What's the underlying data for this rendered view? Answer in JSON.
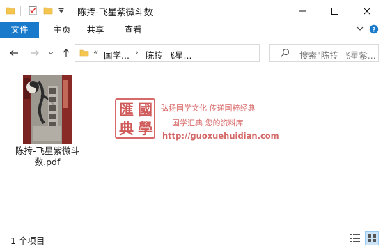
{
  "window": {
    "title": "陈抟-飞星紫微斗数"
  },
  "ribbon": {
    "tabs": [
      "文件",
      "主页",
      "共享",
      "查看"
    ]
  },
  "address": {
    "overflow": "«",
    "crumbs": [
      "国学...",
      "陈抟-飞星..."
    ],
    "search_placeholder": "搜索\"陈抟-飞星紫..."
  },
  "files": [
    {
      "name_line1": "陈抟-飞星紫微斗",
      "name_line2": "数.pdf",
      "icon": "pdf-thumbnail"
    }
  ],
  "watermark": {
    "seal_chars": [
      "匯",
      "國",
      "典",
      "學"
    ],
    "line1": "弘扬国学文化  传递国粹经典",
    "line2": "国学汇典  您的资料库",
    "url": "http://guoxuehuidian.com"
  },
  "status": {
    "count": "1 个项目"
  },
  "colors": {
    "accent": "#1979ca",
    "folder": "#f4c64f",
    "watermark": "#d05a5a"
  }
}
